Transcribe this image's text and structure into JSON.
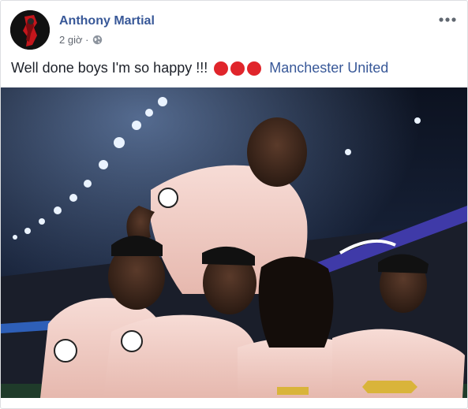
{
  "post": {
    "author": "Anthony Martial",
    "timestamp": "2 giờ ·",
    "privacy_icon": "globe-icon",
    "message": "Well done boys I'm so happy !!!",
    "emoji": [
      "red-circle",
      "red-circle",
      "red-circle"
    ],
    "tag": "Manchester United",
    "more_icon": "more-dots-icon"
  },
  "colors": {
    "link": "#385898",
    "text": "#1d2129",
    "meta": "#616770",
    "emoji_red": "#e0252b",
    "kit": "#f2cfc8"
  }
}
